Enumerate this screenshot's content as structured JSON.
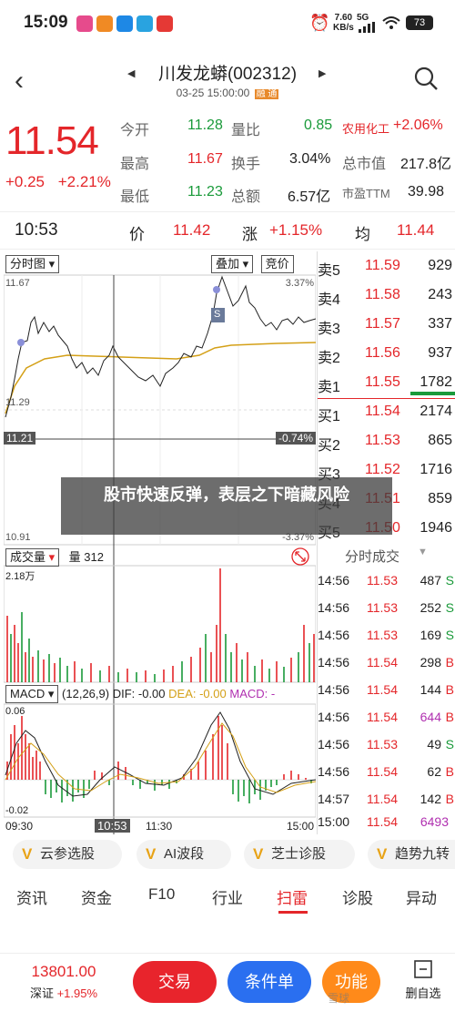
{
  "status": {
    "time": "15:09",
    "net_speed": "7.60",
    "net_unit": "KB/s",
    "signal": "5G",
    "battery": "73"
  },
  "header": {
    "title": "川发龙蟒(002312)",
    "date": "03-25 15:00:00",
    "badge": "融 通"
  },
  "quote": {
    "price": "11.54",
    "change": "+0.25",
    "change_pct": "+2.21%",
    "fields": [
      {
        "label": "今开",
        "value": "11.28"
      },
      {
        "label": "量比",
        "value": "0.85"
      },
      {
        "label": "农用化工",
        "value": "+2.06%"
      },
      {
        "label": "最高",
        "value": "11.67"
      },
      {
        "label": "换手",
        "value": "3.04%"
      },
      {
        "label": "总市值",
        "value": "217.8亿"
      },
      {
        "label": "最低",
        "value": "11.23"
      },
      {
        "label": "总额",
        "value": "6.57亿"
      },
      {
        "label": "市盈TTM",
        "value": "39.98"
      }
    ]
  },
  "cursor_bar": {
    "time": "10:53",
    "price_label": "价",
    "price": "11.42",
    "chg_label": "涨",
    "chg": "+1.15%",
    "avg_label": "均",
    "avg": "11.44"
  },
  "chart": {
    "mode": "分时图",
    "overlay": "叠加",
    "compare": "竞价",
    "y_top": "11.67",
    "y_top_pct": "3.37%",
    "y_mid": "11.29",
    "y_bot": "10.91",
    "y_bot_pct": "-3.37%",
    "cursor_price": "11.21",
    "cursor_pct": "-0.74%",
    "s_marker": "S",
    "vol_label": "成交量",
    "vol_value": "量 312",
    "vol_max": "2.18万",
    "macd_label": "MACD",
    "macd_params": "(12,26,9)",
    "dif": "DIF: -0.00",
    "dea": "DEA: -0.00",
    "macd": "MACD: -",
    "macd_top": "0.06",
    "macd_bot": "-0.02",
    "x_start": "09:30",
    "x_cursor": "10:53",
    "x_mid": "11:30",
    "x_end": "15:00"
  },
  "order_book": [
    {
      "label": "卖5",
      "price": "11.59",
      "vol": "929"
    },
    {
      "label": "卖4",
      "price": "11.58",
      "vol": "243"
    },
    {
      "label": "卖3",
      "price": "11.57",
      "vol": "337"
    },
    {
      "label": "卖2",
      "price": "11.56",
      "vol": "937"
    },
    {
      "label": "卖1",
      "price": "11.55",
      "vol": "1782"
    },
    {
      "label": "买1",
      "price": "11.54",
      "vol": "2174"
    },
    {
      "label": "买2",
      "price": "11.53",
      "vol": "865"
    },
    {
      "label": "买3",
      "price": "11.52",
      "vol": "1716"
    },
    {
      "label": "买4",
      "price": "11.51",
      "vol": "859"
    },
    {
      "label": "买5",
      "price": "11.50",
      "vol": "1946"
    }
  ],
  "ticks_title": "分时成交",
  "ticks": [
    {
      "time": "14:56",
      "price": "11.53",
      "vol": "487",
      "side": "S"
    },
    {
      "time": "14:56",
      "price": "11.53",
      "vol": "252",
      "side": "S"
    },
    {
      "time": "14:56",
      "price": "11.53",
      "vol": "169",
      "side": "S"
    },
    {
      "time": "14:56",
      "price": "11.54",
      "vol": "298",
      "side": "B"
    },
    {
      "time": "14:56",
      "price": "11.54",
      "vol": "144",
      "side": "B"
    },
    {
      "time": "14:56",
      "price": "11.54",
      "vol": "644",
      "side": "B"
    },
    {
      "time": "14:56",
      "price": "11.53",
      "vol": "49",
      "side": "S"
    },
    {
      "time": "14:56",
      "price": "11.54",
      "vol": "62",
      "side": "B"
    },
    {
      "time": "14:57",
      "price": "11.54",
      "vol": "142",
      "side": "B"
    },
    {
      "time": "15:00",
      "price": "11.54",
      "vol": "6493",
      "side": ""
    }
  ],
  "overlay_text": "股市快速反弹，表层之下暗藏风险",
  "pills": [
    "云参选股",
    "AI波段",
    "芝士诊股",
    "趋势九转"
  ],
  "tabs": [
    "资讯",
    "资金",
    "F10",
    "行业",
    "扫雷",
    "诊股",
    "异动"
  ],
  "active_tab": "扫雷",
  "bottom": {
    "index_value": "13801.00",
    "index_name": "深证",
    "index_chg": "+1.95%",
    "trade": "交易",
    "condition": "条件单",
    "function": "功能",
    "delete": "删自选",
    "watermark": "雪球"
  },
  "colors": {
    "red": "#e4262a",
    "green": "#1a9a3a",
    "avg_line": "#d4a017",
    "trade_btn": "#e8242c",
    "cond_btn": "#2a6ff0",
    "func_btn": "#ff8a1a"
  }
}
